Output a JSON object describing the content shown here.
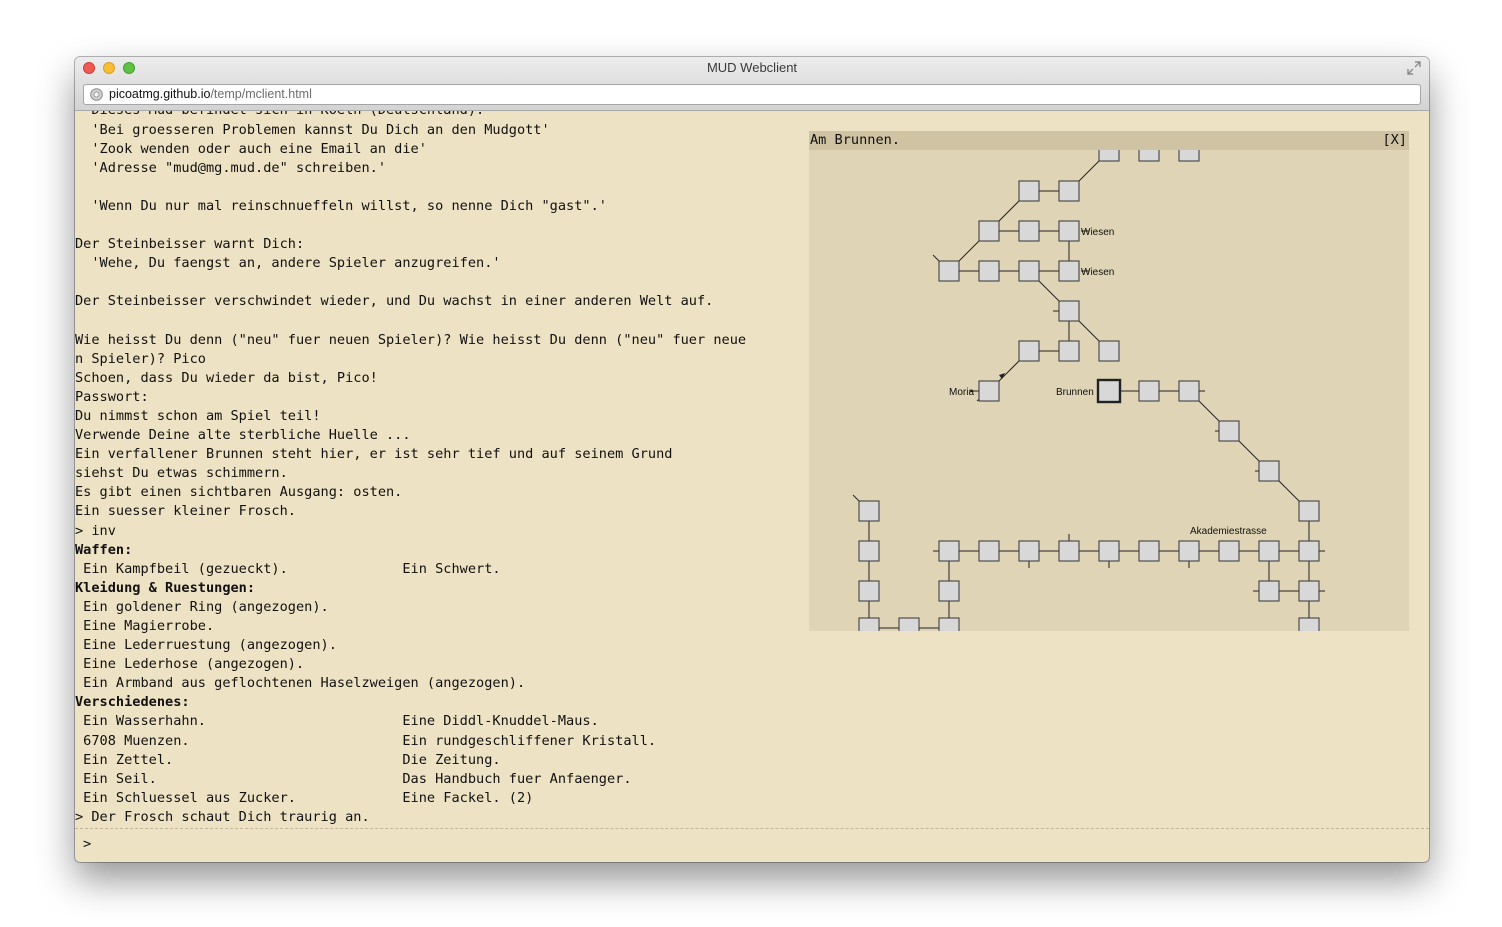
{
  "window": {
    "title": "MUD Webclient",
    "url_host": "picoatmg.github.io",
    "url_path": "/temp/mclient.html"
  },
  "terminal": {
    "lines": [
      {
        "text": "  Dieses Mud befindet sich in Koeln (Deutschland)."
      },
      {
        "text": "  'Bei groesseren Problemen kannst Du Dich an den Mudgott'"
      },
      {
        "text": "  'Zook wenden oder auch eine Email an die'"
      },
      {
        "text": "  'Adresse \"mud@mg.mud.de\" schreiben.'"
      },
      {
        "text": ""
      },
      {
        "text": "  'Wenn Du nur mal reinschnueffeln willst, so nenne Dich \"gast\".'"
      },
      {
        "text": ""
      },
      {
        "text": "Der Steinbeisser warnt Dich:"
      },
      {
        "text": "  'Wehe, Du faengst an, andere Spieler anzugreifen.'"
      },
      {
        "text": ""
      },
      {
        "text": "Der Steinbeisser verschwindet wieder, und Du wachst in einer anderen Welt auf."
      },
      {
        "text": ""
      },
      {
        "text": "Wie heisst Du denn (\"neu\" fuer neuen Spieler)? Wie heisst Du denn (\"neu\" fuer neue"
      },
      {
        "text": "n Spieler)? Pico"
      },
      {
        "text": "Schoen, dass Du wieder da bist, Pico!"
      },
      {
        "text": "Passwort:"
      },
      {
        "text": "Du nimmst schon am Spiel teil!"
      },
      {
        "text": "Verwende Deine alte sterbliche Huelle ..."
      },
      {
        "text": "Ein verfallener Brunnen steht hier, er ist sehr tief und auf seinem Grund"
      },
      {
        "text": "siehst Du etwas schimmern."
      },
      {
        "text": "Es gibt einen sichtbaren Ausgang: osten."
      },
      {
        "text": "Ein suesser kleiner Frosch."
      },
      {
        "text": "> inv"
      },
      {
        "text": "Waffen:",
        "bold": true
      },
      {
        "text": " Ein Kampfbeil (gezueckt).              Ein Schwert."
      },
      {
        "text": "Kleidung & Ruestungen:",
        "bold": true
      },
      {
        "text": " Ein goldener Ring (angezogen)."
      },
      {
        "text": " Eine Magierrobe."
      },
      {
        "text": " Eine Lederruestung (angezogen)."
      },
      {
        "text": " Eine Lederhose (angezogen)."
      },
      {
        "text": " Ein Armband aus geflochtenen Haselzweigen (angezogen)."
      },
      {
        "text": "Verschiedenes:",
        "bold": true
      },
      {
        "text": " Ein Wasserhahn.                        Eine Diddl-Knuddel-Maus."
      },
      {
        "text": " 6708 Muenzen.                          Ein rundgeschliffener Kristall."
      },
      {
        "text": " Ein Zettel.                            Die Zeitung."
      },
      {
        "text": " Ein Seil.                              Das Handbuch fuer Anfaenger."
      },
      {
        "text": " Ein Schluessel aus Zucker.             Eine Fackel. (2)"
      },
      {
        "text": "> Der Frosch schaut Dich traurig an."
      }
    ],
    "prompt": ">",
    "input_value": ""
  },
  "map": {
    "title": "Am Brunnen.",
    "close_label": "[X]",
    "labels": {
      "wiesen_1": "Wiesen",
      "wiesen_2": "Wiesen",
      "moria": "Moria",
      "brunnen": "Brunnen",
      "akademiestrasse": "Akademiestrasse"
    },
    "current_room": "Brunnen"
  }
}
